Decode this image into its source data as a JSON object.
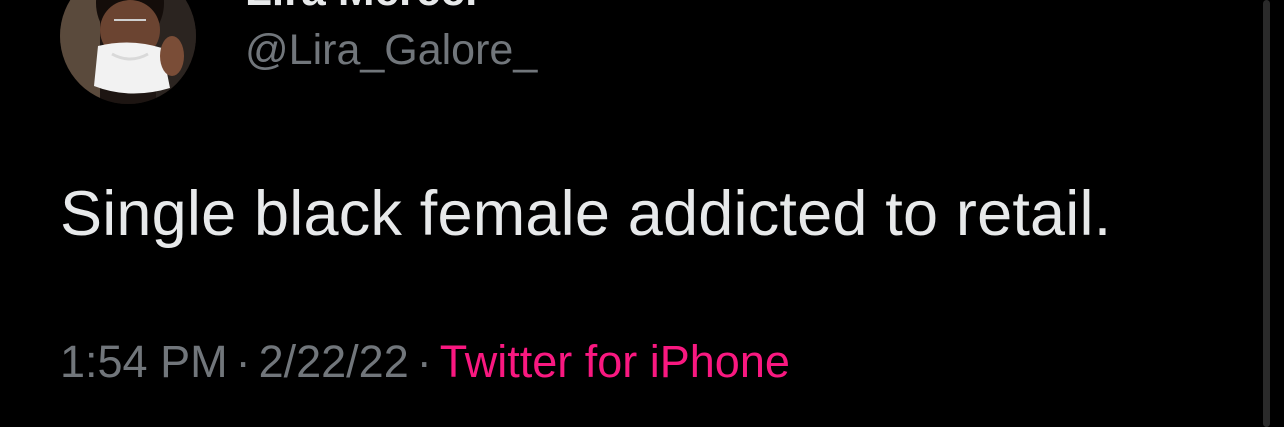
{
  "tweet": {
    "display_name": "Lira Mercer",
    "handle": "@Lira_Galore_",
    "text": "Single black female addicted to retail.",
    "time": "1:54 PM",
    "separator": "·",
    "date": "2/22/22",
    "source": "Twitter for iPhone"
  },
  "colors": {
    "background": "#000000",
    "text": "#e7e9ea",
    "secondary": "#71767b",
    "source_accent": "#f91880"
  },
  "icons": {
    "avatar": "profile-photo"
  }
}
